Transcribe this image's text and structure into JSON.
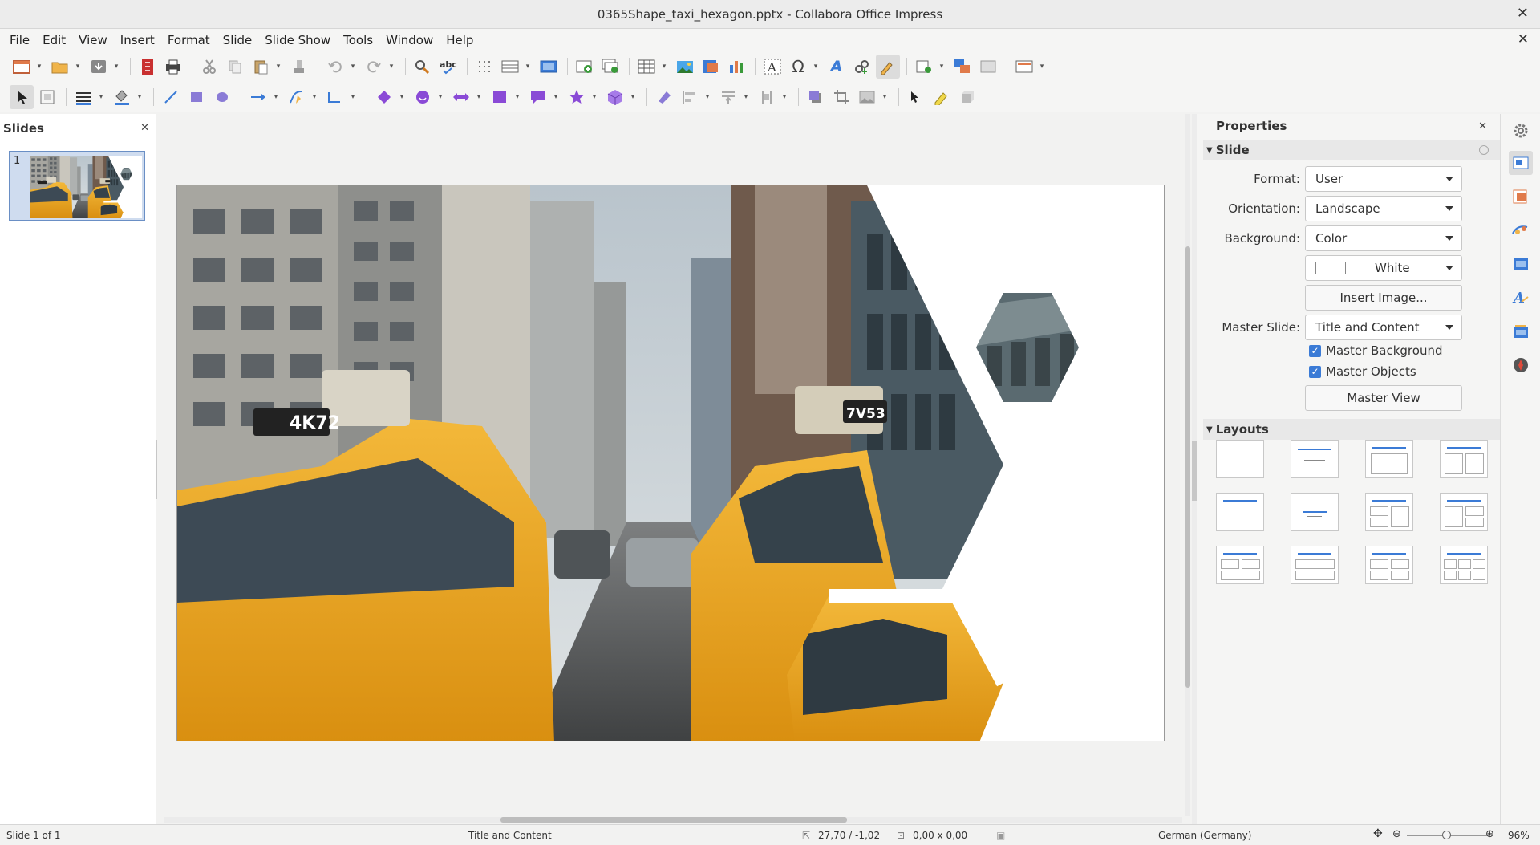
{
  "window": {
    "title": "0365Shape_taxi_hexagon.pptx - Collabora Office Impress"
  },
  "menu": [
    "File",
    "Edit",
    "View",
    "Insert",
    "Format",
    "Slide",
    "Slide Show",
    "Tools",
    "Window",
    "Help"
  ],
  "slides_pane": {
    "title": "Slides",
    "slide_number": "1"
  },
  "slide_image_text": {
    "plate_left": "4K72",
    "plate_right": "7V53"
  },
  "properties": {
    "title": "Properties",
    "slide_section": "Slide",
    "format_label": "Format:",
    "format_value": "User",
    "orientation_label": "Orientation:",
    "orientation_value": "Landscape",
    "background_label": "Background:",
    "background_value": "Color",
    "color_value": "White",
    "insert_image": "Insert Image...",
    "master_slide_label": "Master Slide:",
    "master_slide_value": "Title and Content",
    "master_background": "Master Background",
    "master_objects": "Master Objects",
    "master_view": "Master View",
    "layouts_section": "Layouts"
  },
  "status": {
    "slide": "Slide 1 of 1",
    "layout": "Title and Content",
    "position": "27,70 / -1,02",
    "size": "0,00 x 0,00",
    "language": "German (Germany)",
    "zoom": "96%"
  },
  "colors": {
    "accent": "#3b7bd6",
    "taxi": "#e8a317",
    "selection": "#cfdcef"
  }
}
